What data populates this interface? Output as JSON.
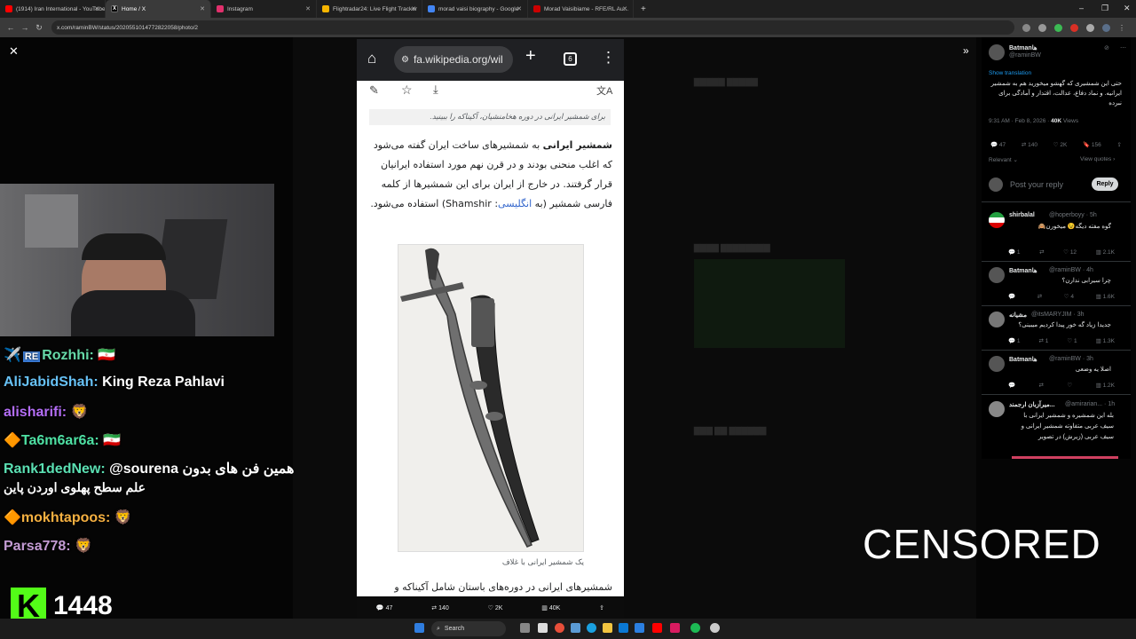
{
  "tabs": [
    {
      "title": "(1914) Iran International - YouTube",
      "fav": "#ff0000"
    },
    {
      "title": "Home / X",
      "fav": "#000",
      "active": true
    },
    {
      "title": "Instagram",
      "fav": "#e1306c"
    },
    {
      "title": "Flightradar24: Live Flight Tracker",
      "fav": "#f7b500"
    },
    {
      "title": "morad vaisi biography - Google",
      "fav": "#4285f4"
    },
    {
      "title": "Morad Vaisibiame - RFE/RL Au...",
      "fav": "#c00"
    }
  ],
  "browser": {
    "url": "x.com/raminBW/status/2020551014772822058/photo/2"
  },
  "phone": {
    "url": "fa.wikipedia.org/wil",
    "tab_count": "6",
    "hatnote": "برای شمشیر ایرانی در دوره هخامنشیان، آکیناکه را ببینید.",
    "para1_bold": "شمشیر ایرانی",
    "para1": " به شمشیرهای ساخت ایران گفته می‌شود که اغلب منحنی بودند و در قرن نهم مورد استفاده ایرانیان قرار گرفتند. در خارج از ایران برای این شمشیرها از کلمه فارسی شمشیر (به ",
    "para1_link": "انگلیسی",
    "para1_end": ": Shamshir) استفاده می‌شود.",
    "caption": "یک شمشیر ایرانی با غلاف",
    "para2": "شمشیرهای ایرانی در دوره‌های باستان شامل آکیناکه و"
  },
  "post_stats": {
    "replies": "47",
    "reposts": "140",
    "likes": "2K",
    "views": "40K"
  },
  "chat": [
    {
      "user": "Rozhhi:",
      "color": "#66d9a8",
      "msg": "🇮🇷",
      "badge": "✈️"
    },
    {
      "user": "AliJabidShah:",
      "color": "#67c1f5",
      "msg": "King Reza Pahlavi"
    },
    {
      "user": "alisharifi:",
      "color": "#b36df5",
      "msg": "🦁"
    },
    {
      "user": "Ta6m6ar6a:",
      "color": "#4ee0a3",
      "msg": "🇮🇷",
      "badge": "🔶"
    },
    {
      "user": "Rank1dedNew:",
      "color": "#5be0b3",
      "msg": "@sourena همین فن های بدون",
      "msg2": "علم سطح پهلوی اوردن پاین"
    },
    {
      "user": "mokhtapoos:",
      "color": "#f5b041",
      "msg": "🦁",
      "badge": "🔶"
    },
    {
      "user": "Parsa778:",
      "color": "#c39bd3",
      "msg": "🦁"
    }
  ],
  "kick": {
    "logo": "K",
    "viewers": "1448"
  },
  "overlay": {
    "censored": "CENSORED"
  },
  "tweet": {
    "name": "Batmanها",
    "handle": "@raminBW",
    "show_translation": "Show translation",
    "text": "حتی این شمشیری که گهشو میخورید هم به شمشیر ایرانیه. و نماد دفاع، عدالت، اقتدار و آمادگی برای نبرده",
    "meta": "9:31 AM · Feb 8, 2026 · ",
    "views": "40K",
    "views_label": " Views",
    "counts": {
      "replies": "47",
      "reposts": "140",
      "likes": "2K",
      "bookmarks": "156"
    },
    "relevant": "Relevant ⌄",
    "view_quotes": "View quotes ›",
    "reply_placeholder": "Post your reply",
    "reply_btn": "Reply"
  },
  "replies": [
    {
      "name": "shirbalal",
      "handle": "@hoperboyy · 5h",
      "text": "گوه مفته دیگه😉 میخورن🙈",
      "stats": [
        "1",
        "",
        "12",
        "2.1K"
      ]
    },
    {
      "name": "Batmanها",
      "handle": "@raminBW · 4h",
      "text": "چرا سیرابی ندارن؟",
      "stats": [
        "",
        "",
        "4",
        "1.6K"
      ]
    },
    {
      "name": "مشیانه",
      "handle": "@itsMARYJIM · 3h",
      "text": "جدیدا زیاد گه خور پیدا کردیم میبینی؟",
      "stats": [
        "1",
        "1",
        "1",
        "1.3K"
      ]
    },
    {
      "name": "Batmanها",
      "handle": "@raminBW · 3h",
      "text": "اصلا یه وضعی",
      "stats": [
        "",
        "",
        "",
        "1.2K"
      ]
    },
    {
      "name": "میرآزبان ارجمند...",
      "handle": "@amirarian... · 1h",
      "text": "بله این شمشیره و شمشیر ایرانی با سیف عربی متفاوته شمشیر ایرانی و سیف عربی (زیرش) در تصویر",
      "stats": []
    }
  ],
  "taskbar": {
    "search": "Search"
  }
}
